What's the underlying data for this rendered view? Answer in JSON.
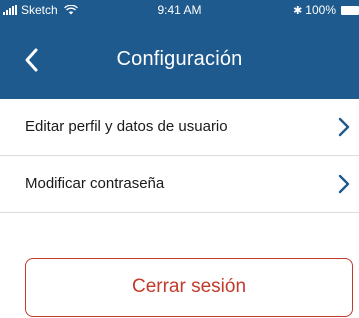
{
  "status_bar": {
    "carrier": "Sketch",
    "time": "9:41 AM",
    "battery": "100%",
    "signal_icon": "signal-bars-icon",
    "wifi_icon": "wifi-icon",
    "bluetooth_icon": "bluetooth-icon",
    "battery_icon": "battery-icon"
  },
  "nav": {
    "title": "Configuración",
    "back_icon": "chevron-left-icon"
  },
  "settings": {
    "items": [
      {
        "label": "Editar perfil y datos de usuario",
        "icon": "chevron-right-icon"
      },
      {
        "label": "Modificar contraseña",
        "icon": "chevron-right-icon"
      }
    ]
  },
  "logout": {
    "label": "Cerrar sesión"
  },
  "colors": {
    "header": "#1f5a8e",
    "accent": "#1f5a8e",
    "danger": "#c23b2b",
    "divider": "#dcdcdc"
  }
}
